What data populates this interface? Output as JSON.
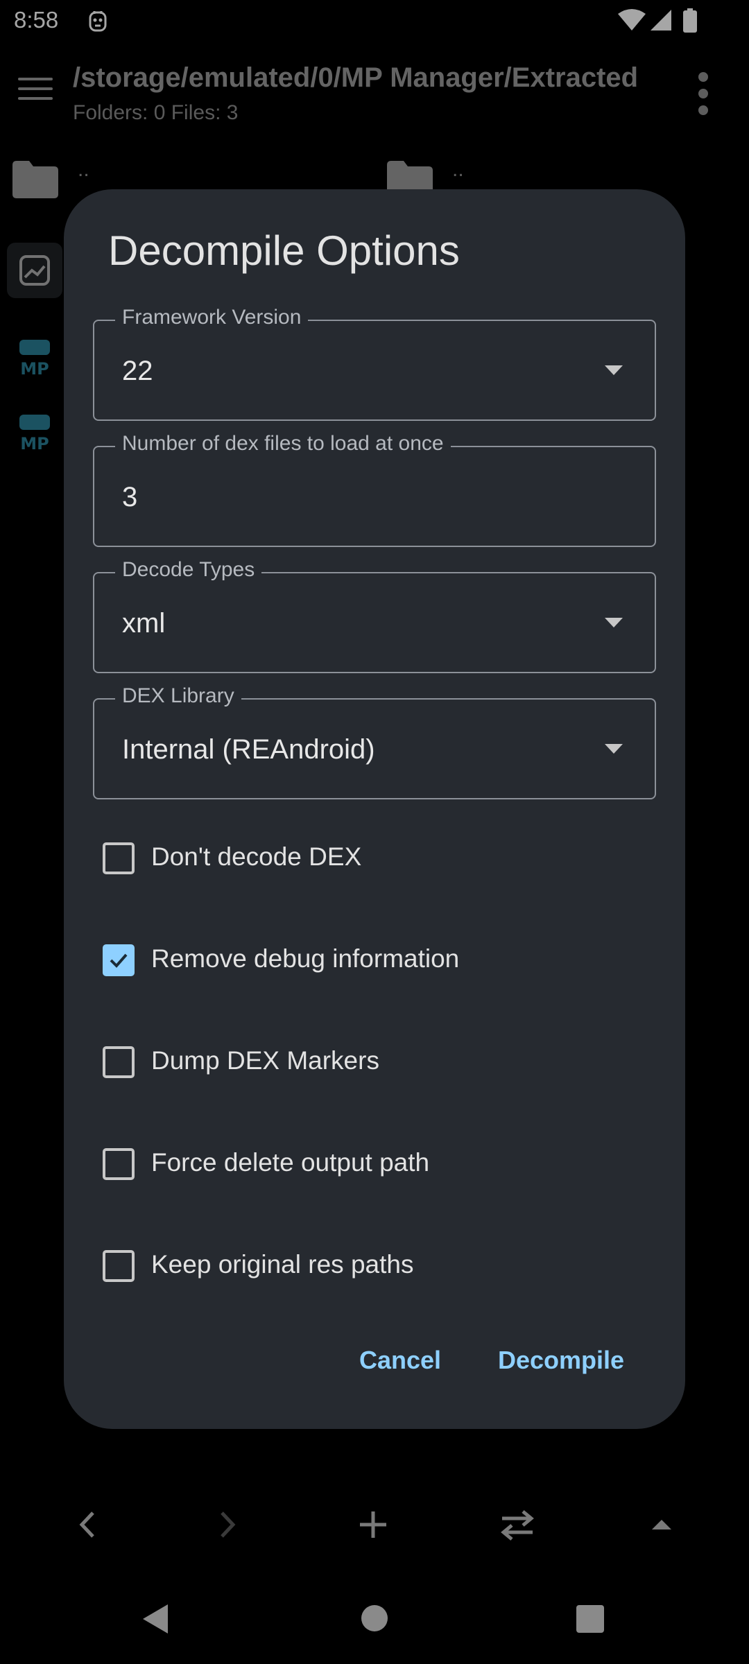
{
  "status_bar": {
    "time": "8:58",
    "icons": [
      "notification-icon",
      "wifi-icon",
      "signal-icon",
      "battery-icon"
    ]
  },
  "app_bar": {
    "path": "/storage/emulated/0/MP Manager/Extracted",
    "summary": "Folders: 0 Files: 3"
  },
  "background": {
    "left_pane_up": "..",
    "right_pane_up": "..",
    "side_items": [
      "analytics-icon",
      "MP",
      "MP"
    ]
  },
  "dialog": {
    "title": "Decompile Options",
    "fields": [
      {
        "label": "Framework Version",
        "value": "22",
        "type": "dropdown"
      },
      {
        "label": "Number of dex files to load at once",
        "value": "3",
        "type": "text"
      },
      {
        "label": "Decode Types",
        "value": "xml",
        "type": "dropdown"
      },
      {
        "label": "DEX Library",
        "value": "Internal (REAndroid)",
        "type": "dropdown"
      }
    ],
    "checkboxes": [
      {
        "label": "Don't decode DEX",
        "checked": false
      },
      {
        "label": "Remove debug information",
        "checked": true
      },
      {
        "label": "Dump DEX Markers",
        "checked": false
      },
      {
        "label": "Force delete output path",
        "checked": false
      },
      {
        "label": "Keep original res paths",
        "checked": false
      }
    ],
    "cancel_label": "Cancel",
    "confirm_label": "Decompile"
  },
  "colors": {
    "accent": "#8ed0ff",
    "dialog_bg": "#262a30",
    "outline": "#8c9199"
  },
  "toolbar": {
    "icons": [
      "back-arrow-icon",
      "forward-arrow-icon",
      "add-icon",
      "swap-icon",
      "up-arrow-icon"
    ]
  },
  "navigation_bar": {
    "icons": [
      "nav-back-icon",
      "nav-home-icon",
      "nav-recents-icon"
    ]
  }
}
